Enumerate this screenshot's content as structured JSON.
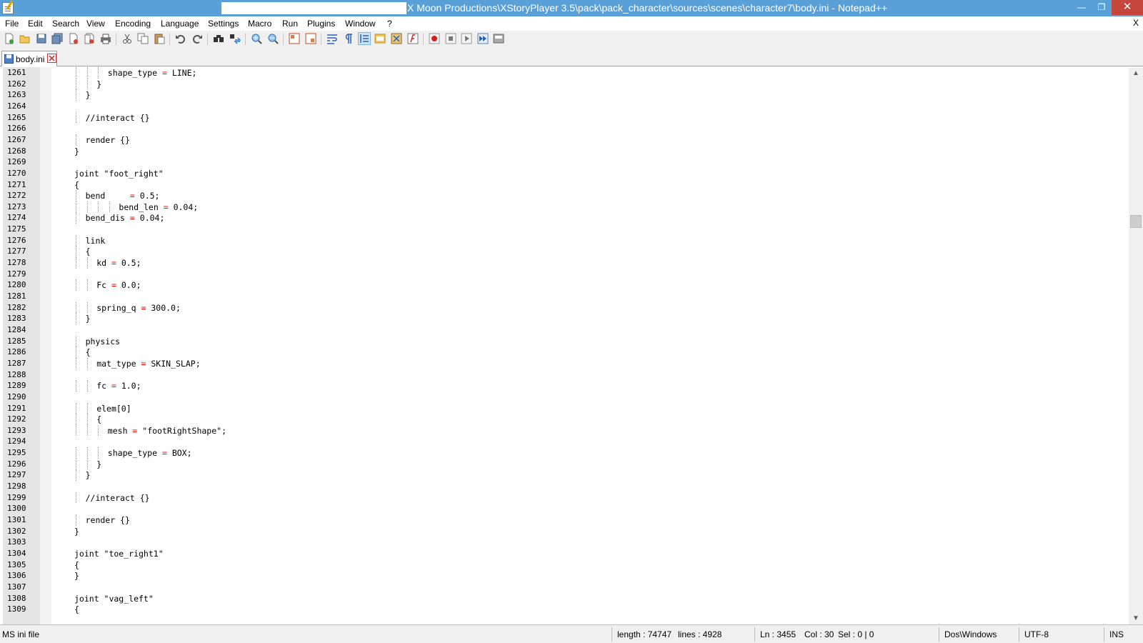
{
  "window": {
    "title": "X Moon Productions\\XStoryPlayer 3.5\\pack\\pack_character\\sources\\scenes\\character7\\body.ini - Notepad++",
    "minimize": "—",
    "maximize": "❐",
    "close": "✕"
  },
  "menu": {
    "items": [
      "File",
      "Edit",
      "Search",
      "View",
      "Encoding",
      "Language",
      "Settings",
      "Macro",
      "Run",
      "Plugins",
      "Window",
      "?"
    ],
    "close": "X"
  },
  "toolbar": {
    "icons": [
      "new-file-icon",
      "open-file-icon",
      "save-icon",
      "save-all-icon",
      "close-icon",
      "close-all-icon",
      "print-icon",
      "cut-icon",
      "copy-icon",
      "paste-icon",
      "undo-icon",
      "redo-icon",
      "find-icon",
      "replace-icon",
      "zoom-in-icon",
      "zoom-out-icon",
      "sync-vertical-icon",
      "sync-horizontal-icon",
      "word-wrap-icon",
      "show-all-chars-icon",
      "indent-guide-icon",
      "language-define-icon",
      "document-map-icon",
      "function-list-icon",
      "macro-record-icon",
      "macro-stop-icon",
      "macro-play-icon",
      "macro-run-multiple-icon",
      "macro-save-icon"
    ]
  },
  "tabs": [
    {
      "label": "body.ini",
      "active": true
    }
  ],
  "editor": {
    "lines": [
      {
        "num": "1261",
        "text": "shape_type = LINE;",
        "indent": 6
      },
      {
        "num": "1262",
        "text": "}",
        "indent": 4
      },
      {
        "num": "1263",
        "text": "}",
        "indent": 2
      },
      {
        "num": "1264",
        "text": "",
        "indent": 0
      },
      {
        "num": "1265",
        "text": "//interact {}",
        "indent": 2
      },
      {
        "num": "1266",
        "text": "",
        "indent": 0
      },
      {
        "num": "1267",
        "text": "render {}",
        "indent": 2
      },
      {
        "num": "1268",
        "text": "}",
        "indent": 0
      },
      {
        "num": "1269",
        "text": "",
        "indent": 0
      },
      {
        "num": "1270",
        "text": "joint \"foot_right\"",
        "indent": 0
      },
      {
        "num": "1271",
        "text": "{",
        "indent": 0
      },
      {
        "num": "1272",
        "text": "bend     = 0.5;",
        "indent": 2
      },
      {
        "num": "1273",
        "text": "bend_len = 0.04;",
        "indent": 8
      },
      {
        "num": "1274",
        "text": "bend_dis = 0.04;",
        "indent": 2
      },
      {
        "num": "1275",
        "text": "",
        "indent": 0
      },
      {
        "num": "1276",
        "text": "link",
        "indent": 2
      },
      {
        "num": "1277",
        "text": "{",
        "indent": 2
      },
      {
        "num": "1278",
        "text": "kd = 0.5;",
        "indent": 4
      },
      {
        "num": "1279",
        "text": "",
        "indent": 0
      },
      {
        "num": "1280",
        "text": "Fc = 0.0;",
        "indent": 4
      },
      {
        "num": "1281",
        "text": "",
        "indent": 0
      },
      {
        "num": "1282",
        "text": "spring_q = 300.0;",
        "indent": 4
      },
      {
        "num": "1283",
        "text": "}",
        "indent": 2
      },
      {
        "num": "1284",
        "text": "",
        "indent": 0
      },
      {
        "num": "1285",
        "text": "physics",
        "indent": 2
      },
      {
        "num": "1286",
        "text": "{",
        "indent": 2
      },
      {
        "num": "1287",
        "text": "mat_type = SKIN_SLAP;",
        "indent": 4
      },
      {
        "num": "1288",
        "text": "",
        "indent": 0
      },
      {
        "num": "1289",
        "text": "fc = 1.0;",
        "indent": 4
      },
      {
        "num": "1290",
        "text": "",
        "indent": 0
      },
      {
        "num": "1291",
        "text": "elem[0]",
        "indent": 4
      },
      {
        "num": "1292",
        "text": "{",
        "indent": 4
      },
      {
        "num": "1293",
        "text": "mesh = \"footRightShape\";",
        "indent": 6
      },
      {
        "num": "1294",
        "text": "",
        "indent": 0
      },
      {
        "num": "1295",
        "text": "shape_type = BOX;",
        "indent": 6
      },
      {
        "num": "1296",
        "text": "}",
        "indent": 4
      },
      {
        "num": "1297",
        "text": "}",
        "indent": 2
      },
      {
        "num": "1298",
        "text": "",
        "indent": 0
      },
      {
        "num": "1299",
        "text": "//interact {}",
        "indent": 2
      },
      {
        "num": "1300",
        "text": "",
        "indent": 0
      },
      {
        "num": "1301",
        "text": "render {}",
        "indent": 2
      },
      {
        "num": "1302",
        "text": "}",
        "indent": 0
      },
      {
        "num": "1303",
        "text": "",
        "indent": 0
      },
      {
        "num": "1304",
        "text": "joint \"toe_right1\"",
        "indent": 0
      },
      {
        "num": "1305",
        "text": "{",
        "indent": 0
      },
      {
        "num": "1306",
        "text": "}",
        "indent": 0
      },
      {
        "num": "1307",
        "text": "",
        "indent": 0
      },
      {
        "num": "1308",
        "text": "joint \"vag_left\"",
        "indent": 0
      },
      {
        "num": "1309",
        "text": "{",
        "indent": 0
      }
    ]
  },
  "scrollbar": {
    "up": "▲",
    "down": "▼"
  },
  "status": {
    "file_type": "MS ini file",
    "length": "length : 74747",
    "lines": "lines : 4928",
    "ln": "Ln : 3455",
    "col": "Col : 30",
    "sel": "Sel : 0 | 0",
    "eol": "Dos\\Windows",
    "encoding": "UTF-8",
    "mode": "INS"
  },
  "colors": {
    "titlebar": "#5aa0d8",
    "operator": "#ff0000",
    "gutter": "#e4e4e4"
  }
}
